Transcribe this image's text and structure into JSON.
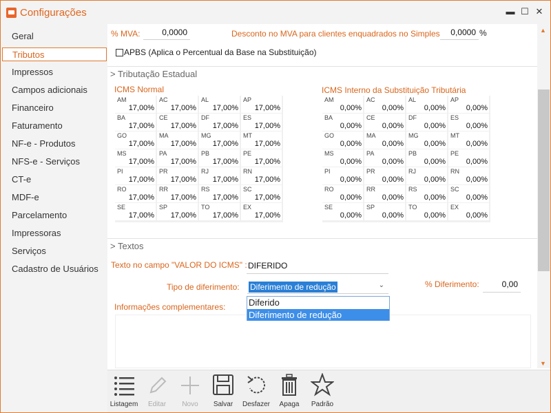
{
  "window": {
    "title": "Configurações",
    "minimize": "▬",
    "maximize": "☐",
    "close": "✕"
  },
  "sidebar": {
    "items": [
      {
        "label": "Geral"
      },
      {
        "label": "Tributos"
      },
      {
        "label": "Impressos"
      },
      {
        "label": "Campos adicionais"
      },
      {
        "label": "Financeiro"
      },
      {
        "label": "Faturamento"
      },
      {
        "label": "NF-e - Produtos"
      },
      {
        "label": "NFS-e - Serviços"
      },
      {
        "label": "CT-e"
      },
      {
        "label": "MDF-e"
      },
      {
        "label": "Parcelamento"
      },
      {
        "label": "Impressoras"
      },
      {
        "label": "Serviços"
      },
      {
        "label": "Cadastro de Usuários"
      }
    ],
    "active_index": 1
  },
  "form": {
    "mva_label": "% MVA:",
    "mva_value": "0,0000",
    "desconto_label": "Desconto no MVA para clientes enquadrados no Simples",
    "desconto_value": "0,0000",
    "desconto_unit": "%",
    "apbs_label": "APBS (Aplica o Percentual da Base na Substituição)",
    "section_estadual": "> Tributação Estadual",
    "icms_normal_title": "ICMS Normal",
    "icms_interno_title": "ICMS Interno da Substituição Tributária",
    "states": [
      "AM",
      "AC",
      "AL",
      "AP",
      "BA",
      "CE",
      "DF",
      "ES",
      "GO",
      "MA",
      "MG",
      "MT",
      "MS",
      "PA",
      "PB",
      "PE",
      "PI",
      "PR",
      "RJ",
      "RN",
      "RO",
      "RR",
      "RS",
      "SC",
      "SE",
      "SP",
      "TO",
      "EX"
    ],
    "icms_normal_values": [
      "17,00%",
      "17,00%",
      "17,00%",
      "17,00%",
      "17,00%",
      "17,00%",
      "17,00%",
      "17,00%",
      "17,00%",
      "17,00%",
      "17,00%",
      "17,00%",
      "17,00%",
      "17,00%",
      "17,00%",
      "17,00%",
      "17,00%",
      "17,00%",
      "17,00%",
      "17,00%",
      "17,00%",
      "17,00%",
      "17,00%",
      "17,00%",
      "17,00%",
      "17,00%",
      "17,00%",
      "17,00%"
    ],
    "icms_interno_values": [
      "0,00%",
      "0,00%",
      "0,00%",
      "0,00%",
      "0,00%",
      "0,00%",
      "0,00%",
      "0,00%",
      "0,00%",
      "0,00%",
      "0,00%",
      "0,00%",
      "0,00%",
      "0,00%",
      "0,00%",
      "0,00%",
      "0,00%",
      "0,00%",
      "0,00%",
      "0,00%",
      "0,00%",
      "0,00%",
      "0,00%",
      "0,00%",
      "0,00%",
      "0,00%",
      "0,00%",
      "0,00%"
    ],
    "section_textos": "> Textos",
    "valor_icms_label": "Texto no campo \"VALOR DO ICMS\" :",
    "valor_icms_value": "DIFERIDO",
    "tipo_diferimento_label": "Tipo de diferimento:",
    "tipo_diferimento_value": "Diferimento de redução",
    "tipo_diferimento_options": [
      "Diferido",
      "Diferimento de redução"
    ],
    "pct_diferimento_label": "% Diferimento:",
    "pct_diferimento_value": "0,00",
    "info_complementares_label": "Informações complementares:"
  },
  "toolbar": {
    "items": [
      {
        "label": "Listagem",
        "icon": "list-icon",
        "enabled": true
      },
      {
        "label": "Editar",
        "icon": "pencil-icon",
        "enabled": false
      },
      {
        "label": "Novo",
        "icon": "plus-icon",
        "enabled": false
      },
      {
        "label": "Salvar",
        "icon": "floppy-icon",
        "enabled": true
      },
      {
        "label": "Desfazer",
        "icon": "undo-icon",
        "enabled": true
      },
      {
        "label": "Apaga",
        "icon": "trash-icon",
        "enabled": true
      },
      {
        "label": "Padrão",
        "icon": "star-icon",
        "enabled": true
      }
    ]
  },
  "colors": {
    "accent": "#e07a2e",
    "label_orange": "#d9651c",
    "select_blue": "#2a7fd6"
  }
}
